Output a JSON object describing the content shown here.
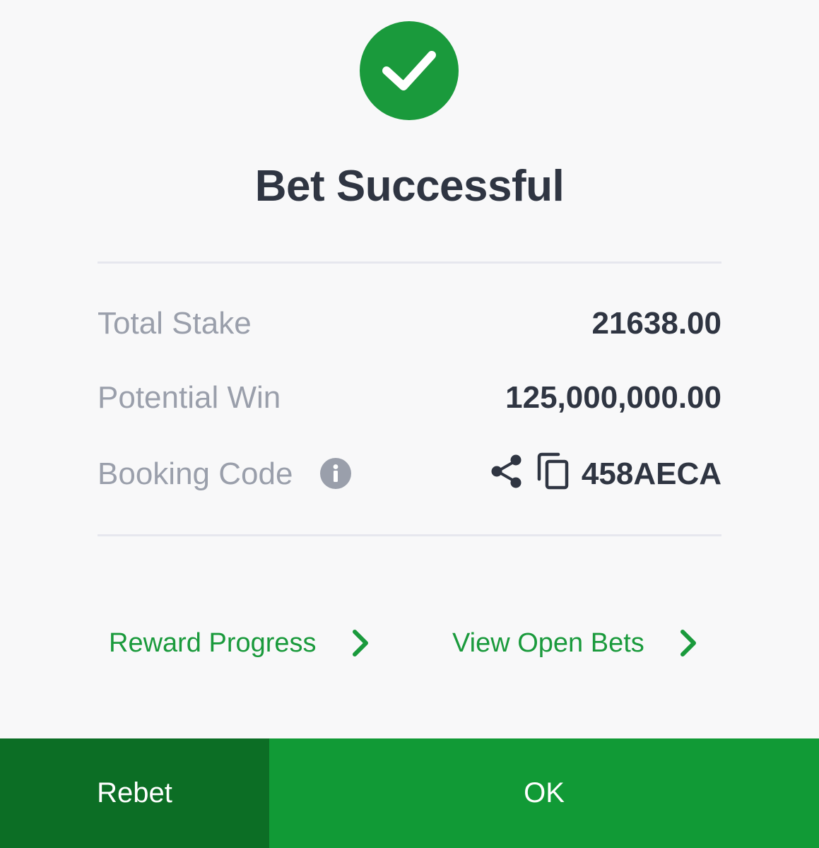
{
  "icons": {
    "success": "check-circle-icon",
    "info": "info-icon",
    "share": "share-icon",
    "copy": "copy-icon",
    "chevron": "chevron-right-icon"
  },
  "colors": {
    "brand_green": "#1a9a3c",
    "rebet_bg": "#0c6e25",
    "ok_bg": "#119a36",
    "text_dark": "#2f3542",
    "text_muted": "#9a9fab"
  },
  "title": "Bet Successful",
  "summary": {
    "total_stake_label": "Total Stake",
    "total_stake_value": "21638.00",
    "potential_win_label": "Potential Win",
    "potential_win_value": "125,000,000.00",
    "booking_code_label": "Booking Code",
    "booking_code_value": "458AECA"
  },
  "links": {
    "reward_progress": "Reward Progress",
    "view_open_bets": "View Open Bets"
  },
  "buttons": {
    "rebet": "Rebet",
    "ok": "OK"
  }
}
